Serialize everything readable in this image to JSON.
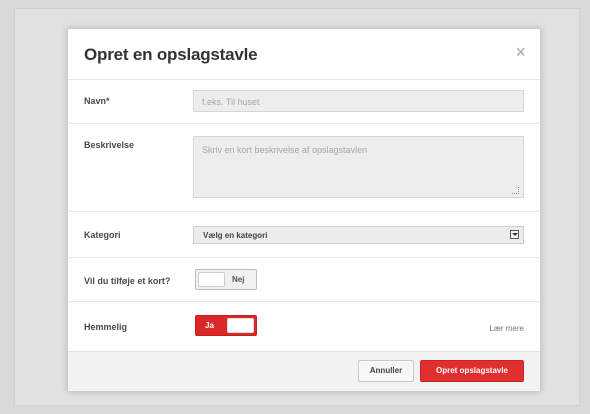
{
  "dialog": {
    "title": "Opret en opslagstavle",
    "close_label": "×"
  },
  "name": {
    "label": "Navn*",
    "placeholder": "f.eks. Til huset",
    "value": ""
  },
  "description": {
    "label": "Beskrivelse",
    "placeholder": "Skriv en kort beskrivelse af opslagstavlen",
    "value": ""
  },
  "category": {
    "label": "Kategori",
    "selected": "Vælg en kategori"
  },
  "add_map": {
    "label": "Vil du tilføje et kort?",
    "state": "Nej"
  },
  "secret": {
    "label": "Hemmelig",
    "state": "Ja",
    "learn_more": "Lær mere"
  },
  "footer": {
    "cancel_label": "Annuller",
    "create_label": "Opret opslagstavle"
  },
  "colors": {
    "accent": "#d9282a",
    "modal_bg": "#ffffff",
    "backdrop": "#e1e1e1"
  }
}
